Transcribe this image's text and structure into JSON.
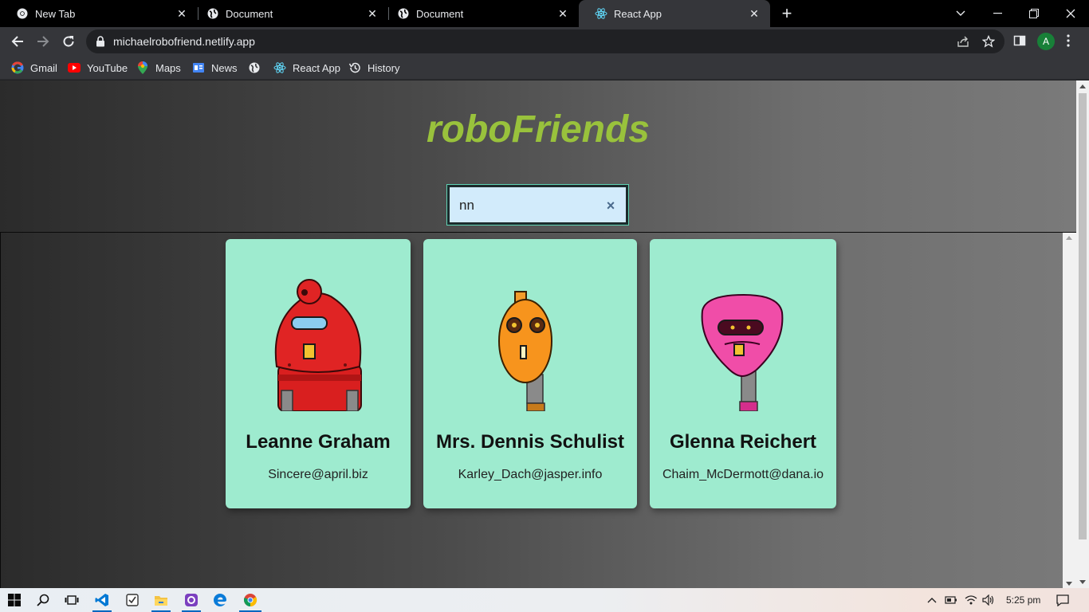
{
  "browser": {
    "tabs": [
      {
        "title": "New Tab",
        "favicon": "chrome-icon",
        "active": false
      },
      {
        "title": "Document",
        "favicon": "globe-icon",
        "active": false
      },
      {
        "title": "Document",
        "favicon": "globe-icon",
        "active": false
      },
      {
        "title": "React App",
        "favicon": "react-icon",
        "active": true
      }
    ],
    "new_tab_label": "+",
    "url": "michaelrobofriend.netlify.app",
    "profile_initial": "A",
    "bookmarks": [
      {
        "label": "Gmail",
        "icon": "google-icon"
      },
      {
        "label": "YouTube",
        "icon": "youtube-icon"
      },
      {
        "label": "Maps",
        "icon": "maps-icon"
      },
      {
        "label": "News",
        "icon": "news-icon"
      },
      {
        "label": "",
        "icon": "globe-icon"
      },
      {
        "label": "React App",
        "icon": "react-icon"
      },
      {
        "label": "History",
        "icon": "history-icon"
      }
    ]
  },
  "app": {
    "title": "roboFriends",
    "search": {
      "value": "nn",
      "clear_label": "×"
    },
    "cards": [
      {
        "name": "Leanne Graham",
        "email": "Sincere@april.biz",
        "robot": "red-robot"
      },
      {
        "name": "Mrs. Dennis Schulist",
        "email": "Karley_Dach@jasper.info",
        "robot": "orange-robot"
      },
      {
        "name": "Glenna Reichert",
        "email": "Chaim_McDermott@dana.io",
        "robot": "pink-robot"
      }
    ]
  },
  "taskbar": {
    "time": "5:25 pm",
    "apps": [
      "windows-start-icon",
      "search-icon",
      "task-view-icon",
      "vscode-icon",
      "snipping-tool-icon",
      "file-explorer-icon",
      "github-desktop-icon",
      "edge-icon",
      "chrome-icon"
    ]
  },
  "colors": {
    "accent_title": "#99c23c",
    "card_bg": "#9eebcf",
    "search_bg": "#d2ebfb"
  }
}
